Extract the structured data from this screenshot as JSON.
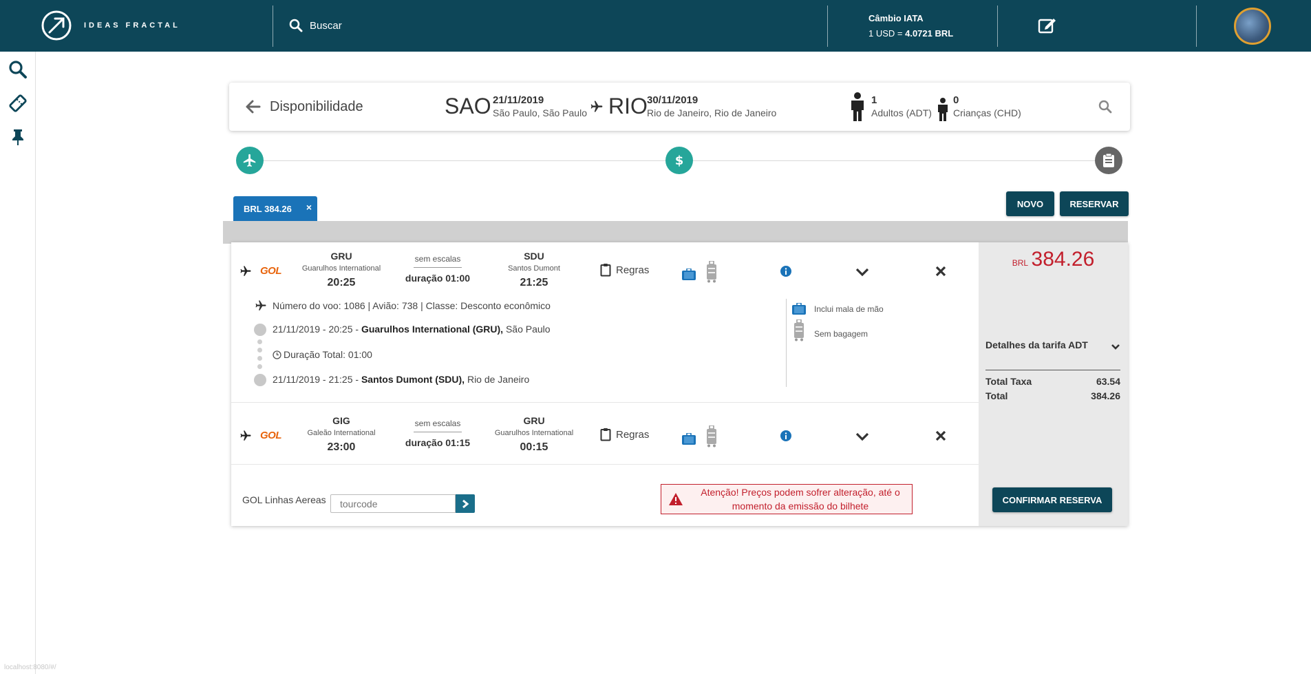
{
  "header": {
    "logo_text": "IDEAS FRACTAL",
    "search_label": "Buscar",
    "cambio_title": "Câmbio IATA",
    "cambio_prefix": "1 USD = ",
    "cambio_value": "4.0721 BRL"
  },
  "footer_url": "localhost:8080/#/",
  "summary": {
    "title": "Disponibilidade",
    "origin": {
      "code": "SAO",
      "date": "21/11/2019",
      "city": "São Paulo, São Paulo"
    },
    "destination": {
      "code": "RIO",
      "date": "30/11/2019",
      "city": "Rio de Janeiro, Rio de Janeiro"
    },
    "adults": {
      "count": "1",
      "label": "Adultos (ADT)"
    },
    "children": {
      "count": "0",
      "label": "Crianças (CHD)"
    }
  },
  "price_tab": {
    "label": "BRL 384.26",
    "close": "×"
  },
  "actions": {
    "novo": "NOVO",
    "reservar": "RESERVAR"
  },
  "segments": [
    {
      "airline": "GOL",
      "from": {
        "code": "GRU",
        "name": "Guarulhos International",
        "time": "20:25"
      },
      "stops": "sem escalas",
      "duration": "duração 01:00",
      "to": {
        "code": "SDU",
        "name": "Santos Dumont",
        "time": "21:25"
      },
      "rules": "Regras"
    },
    {
      "airline": "GOL",
      "from": {
        "code": "GIG",
        "name": "Galeão International",
        "time": "23:00"
      },
      "stops": "sem escalas",
      "duration": "duração 01:15",
      "to": {
        "code": "GRU",
        "name": "Guarulhos International",
        "time": "00:15"
      },
      "rules": "Regras"
    }
  ],
  "details": {
    "flight_info": "Número do voo: 1086 | Avião: 738 | Classe: Desconto econômico",
    "departure_prefix": "21/11/2019 - 20:25 - ",
    "departure_airport": "Guarulhos International (GRU),",
    "departure_city": " São Paulo",
    "total_duration": "Duração Total: 01:00",
    "arrival_prefix": "21/11/2019 - 21:25 - ",
    "arrival_airport": "Santos Dumont (SDU),",
    "arrival_city": " Rio de Janeiro",
    "hand_bag": "Inclui mala de mão",
    "checked_bag": "Sem bagagem"
  },
  "price_panel": {
    "currency": "BRL",
    "amount": "384.26",
    "fare_details": "Detalhes da tarifa ADT",
    "total_taxa_label": "Total Taxa",
    "total_taxa_value": "63.54",
    "total_label": "Total",
    "total_value": "384.26",
    "confirm": "CONFIRMAR RESERVA"
  },
  "footer_row": {
    "airline_name": "GOL Linhas Aereas",
    "tourcode_placeholder": "tourcode",
    "alert": "Atenção! Preços podem sofrer alteração, até o momento da emissão do bilhete"
  },
  "colors": {
    "primary": "#0d4658",
    "accent_teal": "#26a69a",
    "alert_red": "#c21f2c",
    "tab_blue": "#1a73b8",
    "gol_orange": "#e8640c"
  }
}
